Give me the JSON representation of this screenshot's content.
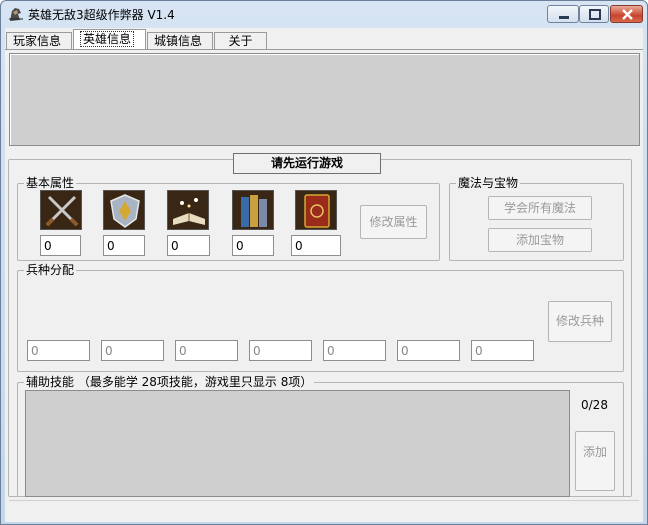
{
  "window": {
    "title": "英雄无敌3超级作弊器 V1.4",
    "colors": {
      "titlebar": "#c2d6ec",
      "close": "#c8442b",
      "panel": "#cfcfcf"
    }
  },
  "tabs": [
    {
      "label": "玩家信息",
      "active": false
    },
    {
      "label": "英雄信息",
      "active": true
    },
    {
      "label": "城镇信息",
      "active": false
    },
    {
      "label": "关于",
      "active": false
    }
  ],
  "status_button": "请先运行游戏",
  "basic_attributes": {
    "label": "基本属性",
    "icons": [
      "attack-swords-icon",
      "defense-shield-icon",
      "spell-power-book-icon",
      "knowledge-books-icon",
      "spellbook-icon"
    ],
    "values": [
      "0",
      "0",
      "0",
      "0",
      "0"
    ],
    "modify_button": "修改属性"
  },
  "magic_treasure": {
    "label": "魔法与宝物",
    "learn_all_button": "学会所有魔法",
    "add_treasure_button": "添加宝物"
  },
  "troops": {
    "label": "兵种分配",
    "values": [
      "0",
      "0",
      "0",
      "0",
      "0",
      "0",
      "0"
    ],
    "modify_button": "修改兵种"
  },
  "skills": {
    "label": "辅助技能 （最多能学 28项技能，游戏里只显示 8项）",
    "count": "0/28",
    "add_button": "添加"
  }
}
